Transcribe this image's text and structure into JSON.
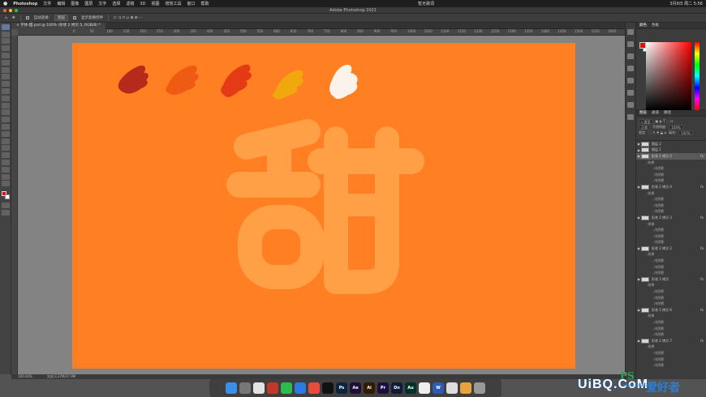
{
  "menubar": {
    "app_name": "Photoshop",
    "items": [
      "文件",
      "编辑",
      "图像",
      "图层",
      "文字",
      "选择",
      "滤镜",
      "3D",
      "视图",
      "增效工具",
      "窗口",
      "帮助"
    ],
    "center_label": "暂无歌词",
    "datetime": "3月9日 周二 5:56"
  },
  "window": {
    "title": "Adobe Photoshop 2021"
  },
  "options": {
    "auto_select_label": "自动选择:",
    "auto_select_value": "图层",
    "transform_label": "显示变换控件"
  },
  "document": {
    "tab_label": "字体-甜.psd @ 100% (形状 2 拷贝 5, RGB/8) *"
  },
  "ruler": {
    "ticks": [
      "0",
      "50",
      "100",
      "150",
      "200",
      "250",
      "300",
      "350",
      "400",
      "450",
      "500",
      "550",
      "600",
      "650",
      "700",
      "750",
      "800",
      "850",
      "900",
      "950",
      "1000",
      "1050",
      "1100",
      "1150",
      "1200",
      "1250",
      "1300",
      "1350",
      "1400",
      "1450",
      "1500",
      "1550",
      "1600",
      "1650"
    ]
  },
  "status": {
    "zoom": "100.00%",
    "doc_info": "文档:3.37M/27.9M"
  },
  "canvas": {
    "background": "#ff7f22",
    "glyph_color": "#ffa047",
    "swatch_colors": [
      "#b52a1b",
      "#ef5b12",
      "#e43a15",
      "#f0a80c",
      "#fbf3eb"
    ]
  },
  "panels": {
    "color_tabs": [
      "颜色",
      "色板"
    ],
    "layer_tabs": [
      "图层",
      "通道",
      "路径"
    ],
    "filter_label": "类型",
    "blend_mode": "正常",
    "opacity_label": "不透明度:",
    "opacity_value": "100%",
    "lock_label": "锁定:",
    "fill_label": "填充:",
    "fill_value": "100%",
    "colors": {
      "foreground": "#ff0000",
      "background": "#ffffff"
    }
  },
  "layers": [
    {
      "kind": "layer",
      "name": "图层 2",
      "thumb": "white"
    },
    {
      "kind": "layer",
      "name": "图层 1",
      "thumb": "white"
    },
    {
      "kind": "layer",
      "name": "形状 2 拷贝 5",
      "thumb": "white",
      "selected": true,
      "fx": true
    },
    {
      "kind": "fx",
      "name": "效果"
    },
    {
      "kind": "effect",
      "name": "内阴影"
    },
    {
      "kind": "effect",
      "name": "内阴影"
    },
    {
      "kind": "effect",
      "name": "内阴影"
    },
    {
      "kind": "layer",
      "name": "形状 2 拷贝 4",
      "thumb": "white",
      "fx": true
    },
    {
      "kind": "fx",
      "name": "效果"
    },
    {
      "kind": "effect",
      "name": "内阴影"
    },
    {
      "kind": "effect",
      "name": "内阴影"
    },
    {
      "kind": "effect",
      "name": "内阴影"
    },
    {
      "kind": "layer",
      "name": "形状 2 拷贝 3",
      "thumb": "white",
      "fx": true
    },
    {
      "kind": "fx",
      "name": "效果"
    },
    {
      "kind": "effect",
      "name": "内阴影"
    },
    {
      "kind": "effect",
      "name": "内阴影"
    },
    {
      "kind": "effect",
      "name": "内阴影"
    },
    {
      "kind": "layer",
      "name": "形状 2 拷贝 2",
      "thumb": "white",
      "fx": true
    },
    {
      "kind": "fx",
      "name": "效果"
    },
    {
      "kind": "effect",
      "name": "内阴影"
    },
    {
      "kind": "effect",
      "name": "内阴影"
    },
    {
      "kind": "effect",
      "name": "内阴影"
    },
    {
      "kind": "layer",
      "name": "形状 2 拷贝",
      "thumb": "white",
      "fx": true
    },
    {
      "kind": "fx",
      "name": "效果"
    },
    {
      "kind": "effect",
      "name": "内阴影"
    },
    {
      "kind": "effect",
      "name": "内阴影"
    },
    {
      "kind": "effect",
      "name": "内阴影"
    },
    {
      "kind": "layer",
      "name": "形状 2 拷贝 6",
      "thumb": "white",
      "fx": true
    },
    {
      "kind": "fx",
      "name": "效果"
    },
    {
      "kind": "effect",
      "name": "内阴影"
    },
    {
      "kind": "effect",
      "name": "内阴影"
    },
    {
      "kind": "effect",
      "name": "内阴影"
    },
    {
      "kind": "layer",
      "name": "形状 2 拷贝 7",
      "thumb": "white",
      "fx": true
    },
    {
      "kind": "fx",
      "name": "效果"
    },
    {
      "kind": "effect",
      "name": "内阴影"
    },
    {
      "kind": "effect",
      "name": "内阴影"
    },
    {
      "kind": "effect",
      "name": "内阴影"
    }
  ],
  "dock": [
    {
      "name": "finder",
      "color": "#3b8fe8",
      "label": ""
    },
    {
      "name": "launchpad",
      "color": "#777",
      "label": ""
    },
    {
      "name": "chrome",
      "color": "#e3e3e3",
      "label": ""
    },
    {
      "name": "xmind",
      "color": "#c0392b",
      "label": ""
    },
    {
      "name": "wechat",
      "color": "#2dbb4e",
      "label": ""
    },
    {
      "name": "safari",
      "color": "#2b7be2",
      "label": ""
    },
    {
      "name": "music",
      "color": "#e74c3c",
      "label": ""
    },
    {
      "name": "qq",
      "color": "#111",
      "label": ""
    },
    {
      "name": "photoshop",
      "color": "#0b2440",
      "label": "Ps"
    },
    {
      "name": "after-effects",
      "color": "#1f0e3a",
      "label": "Ae"
    },
    {
      "name": "illustrator",
      "color": "#301b00",
      "label": "Ai"
    },
    {
      "name": "premiere",
      "color": "#1d0f3d",
      "label": "Pr"
    },
    {
      "name": "dimension",
      "color": "#101a3a",
      "label": "Dn"
    },
    {
      "name": "audition",
      "color": "#00312a",
      "label": "Au"
    },
    {
      "name": "edge",
      "color": "#eee",
      "label": ""
    },
    {
      "name": "word",
      "color": "#2b5db4",
      "label": "W"
    },
    {
      "name": "preview",
      "color": "#ddd",
      "label": ""
    },
    {
      "name": "photos",
      "color": "#e8a33d",
      "label": ""
    },
    {
      "name": "trash",
      "color": "#999",
      "label": ""
    }
  ],
  "watermark": {
    "ps": "PS",
    "word1": "爱好者",
    "site": "UiBQ.CoM",
    "url": "www.psahz.com"
  }
}
